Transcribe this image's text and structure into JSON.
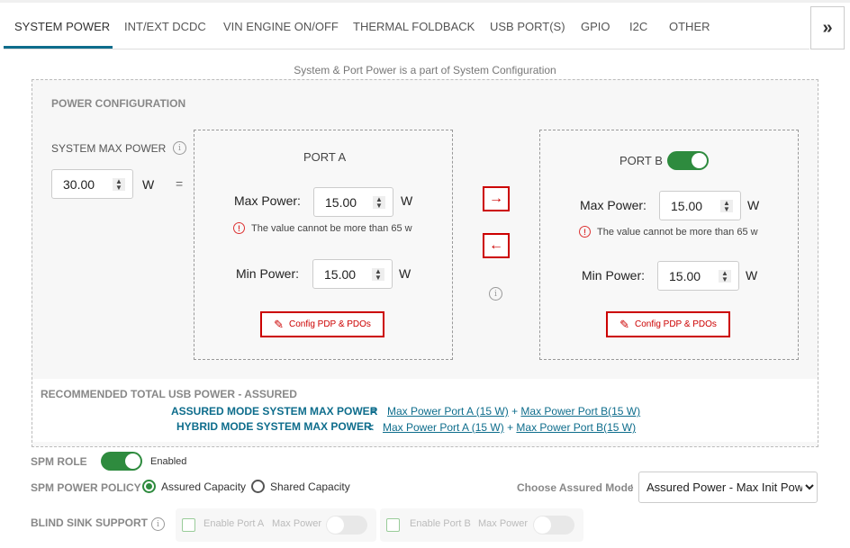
{
  "tabs": [
    {
      "label": "SYSTEM POWER",
      "active": true
    },
    {
      "label": "INT/EXT DCDC"
    },
    {
      "label": "VIN ENGINE ON/OFF"
    },
    {
      "label": "THERMAL FOLDBACK"
    },
    {
      "label": "USB PORT(S)"
    },
    {
      "label": "GPIO"
    },
    {
      "label": "I2C"
    },
    {
      "label": "OTHER"
    }
  ],
  "more_label": "»",
  "subtitle": "System & Port Power is a part of System Configuration",
  "power_config": {
    "title": "POWER CONFIGURATION",
    "system_max_power": {
      "label": "SYSTEM MAX POWER",
      "value": "30.00",
      "unit": "W",
      "equals": "="
    },
    "port_a": {
      "title": "PORT A",
      "max_label": "Max Power:",
      "max_value": "15.00",
      "min_label": "Min Power:",
      "min_value": "15.00",
      "unit": "W",
      "error": "The value cannot be more than 65 w",
      "config_label": "Config PDP & PDOs"
    },
    "port_b": {
      "title": "PORT B",
      "enabled": true,
      "max_label": "Max Power:",
      "max_value": "15.00",
      "min_label": "Min Power:",
      "min_value": "15.00",
      "unit": "W",
      "error": "The value cannot be more than 65 w",
      "config_label": "Config PDP & PDOs"
    },
    "arrow_right": "→",
    "arrow_left": "←"
  },
  "recommended": {
    "title": "RECOMMENDED TOTAL USB POWER - ASSURED",
    "assured": {
      "label": "ASSURED MODE SYSTEM MAX POWER",
      "op": "=",
      "link_a": "Max Power Port A (15 W)",
      "plus": "+",
      "link_b": "Max Power Port B(15 W)"
    },
    "hybrid": {
      "label": "HYBRID MODE SYSTEM MAX POWER",
      "op": "<",
      "link_a": "Max Power Port A (15 W)",
      "plus": "+",
      "link_b": "Max Power Port B(15 W)"
    }
  },
  "spm_role": {
    "label": "SPM ROLE",
    "enabled": true,
    "state": "Enabled"
  },
  "spm_policy": {
    "label": "SPM POWER POLICY",
    "options": [
      "Assured Capacity",
      "Shared Capacity"
    ],
    "selected": "Assured Capacity"
  },
  "assured_mode": {
    "label": "Choose Assured Mode",
    "colon": ":",
    "value": "Assured Power - Max Init Power"
  },
  "blind_sink": {
    "label": "BLIND SINK SUPPORT",
    "port_a": "Enable Port A",
    "port_b": "Enable Port B",
    "max_power": "Max Power"
  },
  "colors": {
    "accent": "#0e6d8c",
    "danger": "#cc0000",
    "toggle_on": "#2e8b3e"
  }
}
